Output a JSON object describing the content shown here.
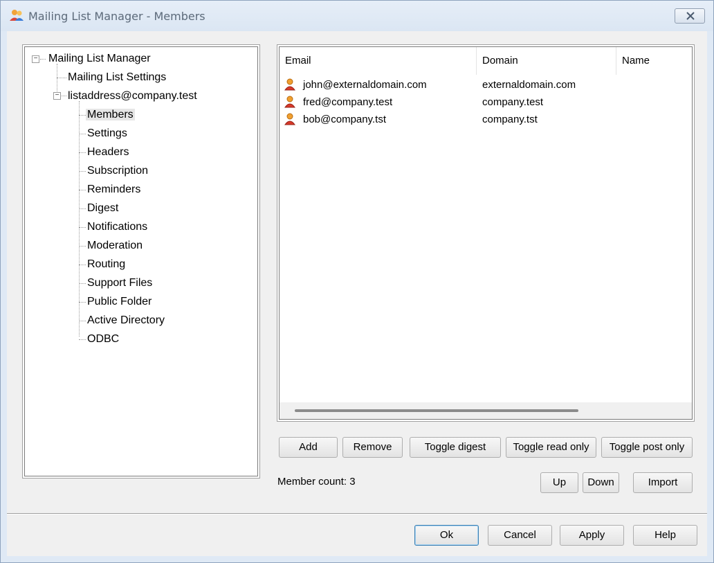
{
  "window": {
    "title": "Mailing List Manager - Members"
  },
  "tree": {
    "root_label": "Mailing List Manager",
    "items": [
      {
        "label": "Mailing List Settings"
      },
      {
        "label": "listaddress@company.test"
      }
    ],
    "list_children": [
      {
        "label": "Members"
      },
      {
        "label": "Settings"
      },
      {
        "label": "Headers"
      },
      {
        "label": "Subscription"
      },
      {
        "label": "Reminders"
      },
      {
        "label": "Digest"
      },
      {
        "label": "Notifications"
      },
      {
        "label": "Moderation"
      },
      {
        "label": "Routing"
      },
      {
        "label": "Support Files"
      },
      {
        "label": "Public Folder"
      },
      {
        "label": "Active Directory"
      },
      {
        "label": "ODBC"
      }
    ],
    "selected": "Members"
  },
  "members_list": {
    "columns": [
      "Email",
      "Domain",
      "Name"
    ],
    "rows": [
      {
        "email": "john@externaldomain.com",
        "domain": "externaldomain.com",
        "name": ""
      },
      {
        "email": "fred@company.test",
        "domain": "company.test",
        "name": ""
      },
      {
        "email": "bob@company.tst",
        "domain": "company.tst",
        "name": ""
      }
    ]
  },
  "actions": {
    "add": "Add",
    "remove": "Remove",
    "toggle_digest": "Toggle digest",
    "toggle_read_only": "Toggle read only",
    "toggle_post_only": "Toggle post only",
    "up": "Up",
    "down": "Down",
    "import": "Import"
  },
  "status": {
    "member_count": "Member count: 3"
  },
  "dialog_buttons": {
    "ok": "Ok",
    "cancel": "Cancel",
    "apply": "Apply",
    "help": "Help"
  },
  "colors": {
    "client_bg": "#f0f0f0",
    "frame_bg": "#dfe9f5",
    "default_button_border": "#3c7fb1"
  }
}
